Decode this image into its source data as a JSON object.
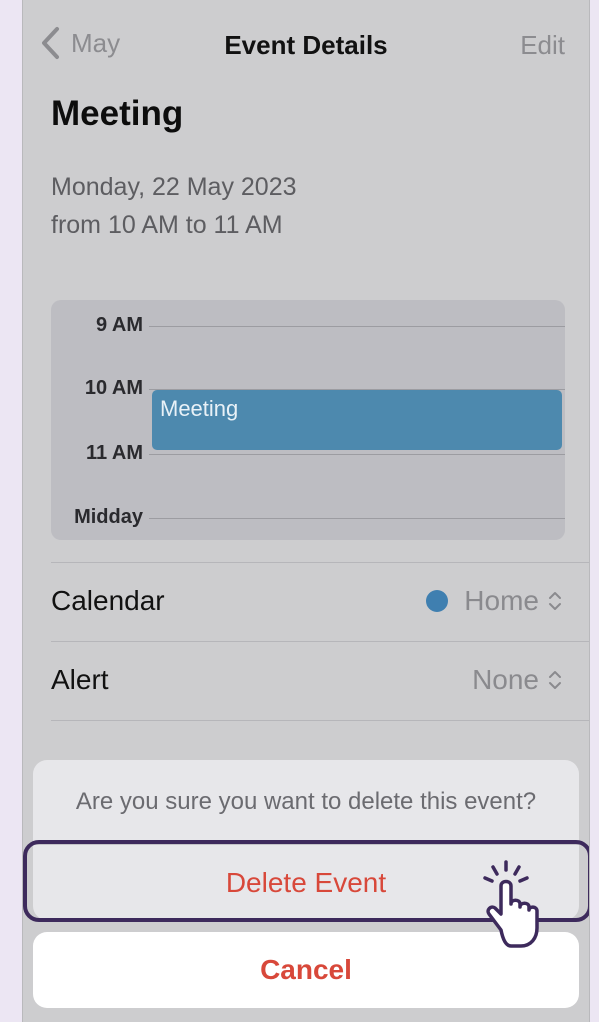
{
  "nav": {
    "back_label": "May",
    "title": "Event Details",
    "edit_label": "Edit"
  },
  "event": {
    "title": "Meeting",
    "date_line": "Monday, 22 May 2023",
    "time_line": "from 10 AM to 11 AM"
  },
  "day_view": {
    "hours": [
      "9 AM",
      "10 AM",
      "11 AM",
      "Midday"
    ],
    "event_label": "Meeting",
    "event_color": "#4d89ae"
  },
  "details": {
    "calendar": {
      "label": "Calendar",
      "value": "Home",
      "dot_color": "#3f7fb0"
    },
    "alert": {
      "label": "Alert",
      "value": "None"
    }
  },
  "action_sheet": {
    "question": "Are you sure you want to delete this event?",
    "delete_label": "Delete Event",
    "cancel_label": "Cancel",
    "destructive_color": "#d8483a"
  }
}
